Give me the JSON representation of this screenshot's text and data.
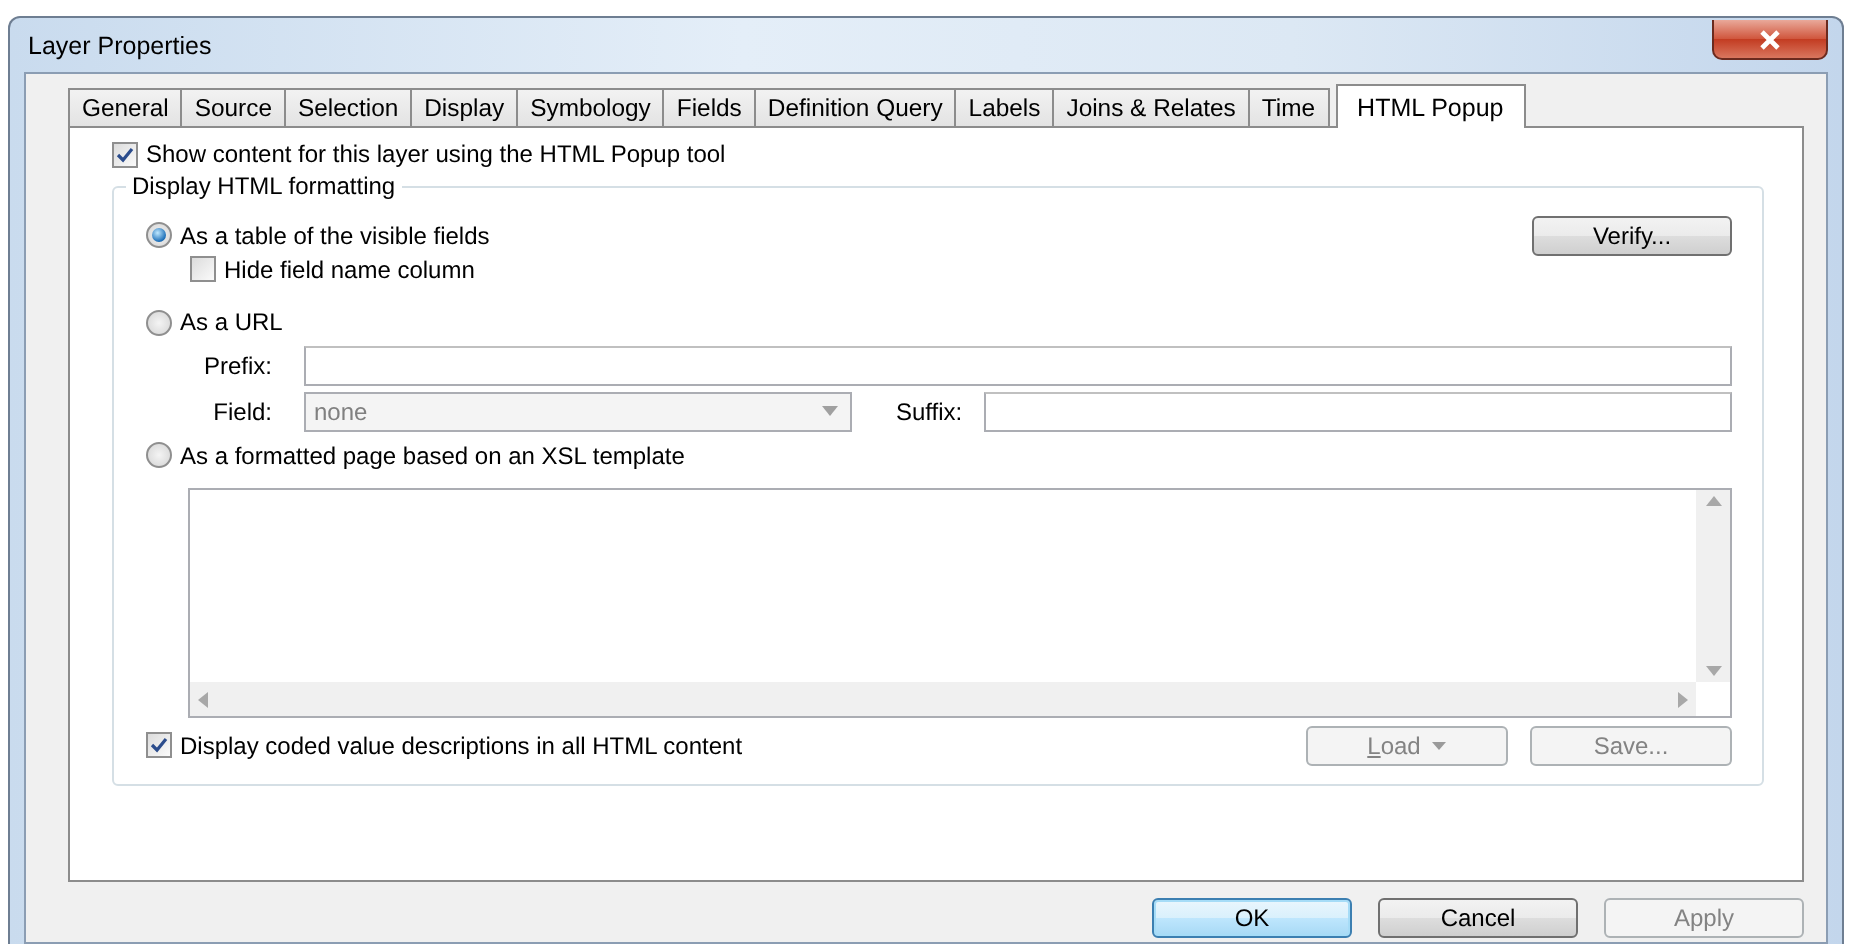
{
  "window": {
    "title": "Layer Properties"
  },
  "tabs": [
    {
      "label": "General",
      "selected": false
    },
    {
      "label": "Source",
      "selected": false
    },
    {
      "label": "Selection",
      "selected": false
    },
    {
      "label": "Display",
      "selected": false
    },
    {
      "label": "Symbology",
      "selected": false
    },
    {
      "label": "Fields",
      "selected": false
    },
    {
      "label": "Definition Query",
      "selected": false
    },
    {
      "label": "Labels",
      "selected": false
    },
    {
      "label": "Joins & Relates",
      "selected": false
    },
    {
      "label": "Time",
      "selected": false
    },
    {
      "label": "HTML Popup",
      "selected": true
    }
  ],
  "show_content": {
    "label": "Show content for this layer using the HTML Popup tool",
    "checked": true
  },
  "group": {
    "title": "Display HTML formatting",
    "options": [
      {
        "label": "As a table of the visible fields",
        "selected": true
      },
      {
        "label": "As a URL",
        "selected": false
      },
      {
        "label": "As a formatted page based on an XSL template",
        "selected": false
      }
    ],
    "hide_field_name": {
      "label": "Hide field name column",
      "checked": false
    },
    "verify_button": {
      "label": "Verify...",
      "disabled": false
    },
    "prefix": {
      "label": "Prefix:"
    },
    "field": {
      "label": "Field:",
      "value": "none",
      "disabled": true
    },
    "suffix": {
      "label": "Suffix:"
    },
    "coded_values": {
      "label": "Display coded value descriptions in all HTML content",
      "checked": true
    },
    "load_button": {
      "label": "Load",
      "disabled": true
    },
    "save_button": {
      "label": "Save...",
      "disabled": true
    }
  },
  "buttons": [
    {
      "label": "OK",
      "default": true,
      "disabled": false
    },
    {
      "label": "Cancel",
      "default": false,
      "disabled": false
    },
    {
      "label": "Apply",
      "default": false,
      "disabled": true
    }
  ]
}
